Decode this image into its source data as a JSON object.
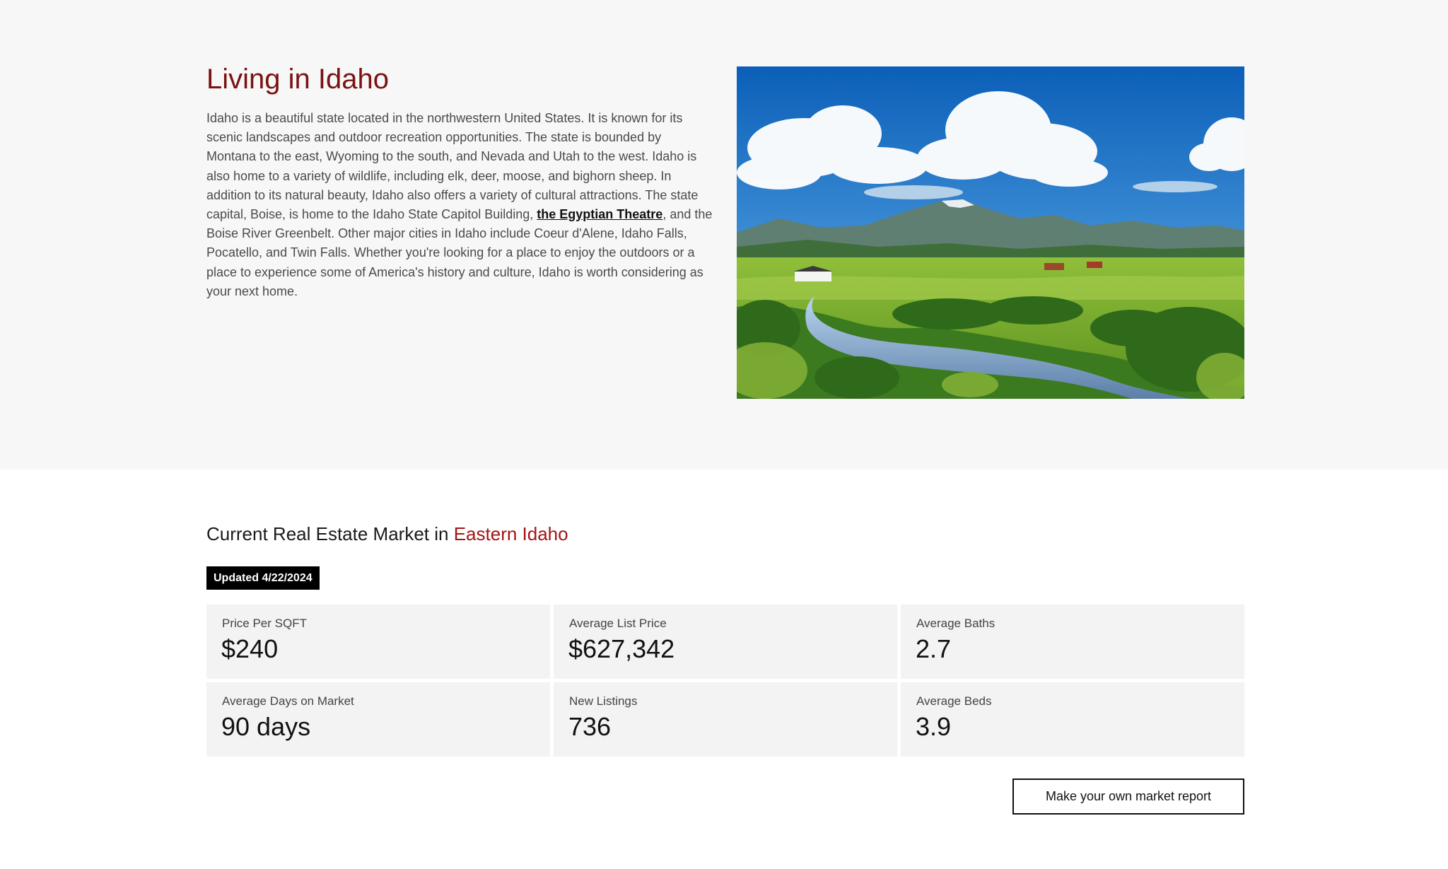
{
  "living": {
    "title": "Living in Idaho",
    "paragraph_before_link": "Idaho is a beautiful state located in the northwestern United States. It is known for its scenic landscapes and outdoor recreation opportunities. The state is bounded by Montana to the east, Wyoming to the south, and Nevada and Utah to the west. Idaho is also home to a variety of wildlife, including elk, deer, moose, and bighorn sheep. In addition to its natural beauty, Idaho also offers a variety of cultural attractions. The state capital, Boise, is home to the Idaho State Capitol Building, ",
    "link_text": "the Egyptian Theatre",
    "paragraph_after_link": ", and the Boise River Greenbelt. Other major cities in Idaho include Coeur d'Alene, Idaho Falls, Pocatello, and Twin Falls. Whether you're looking for a place to enjoy the outdoors or a place to experience some of America's history and culture, Idaho is worth considering as your next home."
  },
  "market": {
    "title_prefix": "Current Real Estate Market in ",
    "region": "Eastern Idaho",
    "updated": "Updated 4/22/2024",
    "stats": [
      {
        "label": "Price Per SQFT",
        "value": "$240"
      },
      {
        "label": "Average List Price",
        "value": "$627,342"
      },
      {
        "label": "Average Baths",
        "value": "2.7"
      },
      {
        "label": "Average Days on Market",
        "value": "90 days"
      },
      {
        "label": "New Listings",
        "value": "736"
      },
      {
        "label": "Average Beds",
        "value": "3.9"
      }
    ],
    "report_button": "Make your own market report"
  },
  "colors": {
    "title_accent": "#7a1212",
    "region_accent": "#a31414",
    "section_background": "#f7f7f7",
    "stat_background": "#f3f3f3"
  }
}
